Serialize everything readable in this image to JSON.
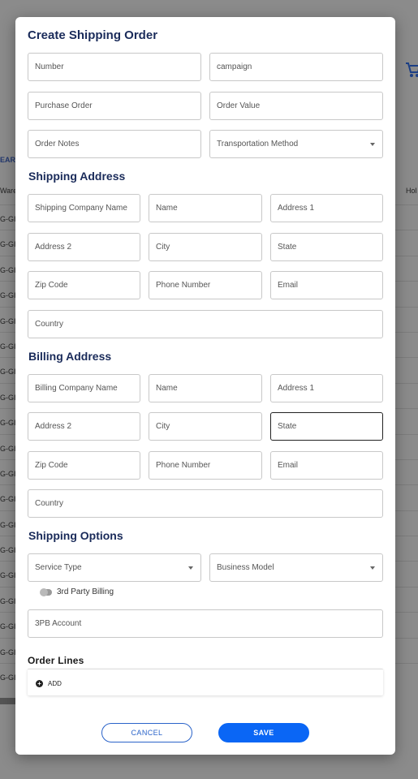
{
  "background": {
    "clear_label": "EAR",
    "col_left": "Ware",
    "col_right": "Hol",
    "row_text": "G-GI",
    "row_count": 19
  },
  "modal": {
    "title": "Create Shipping Order",
    "order_fields": {
      "number": "Number",
      "campaign": "campaign",
      "purchase_order": "Purchase Order",
      "order_value": "Order Value",
      "order_notes": "Order Notes",
      "transportation_method": "Transportation Method"
    },
    "shipping_address": {
      "title": "Shipping Address",
      "company": "Shipping Company Name",
      "name": "Name",
      "address1": "Address 1",
      "address2": "Address 2",
      "city": "City",
      "state": "State",
      "zip": "Zip Code",
      "phone": "Phone Number",
      "email": "Email",
      "country": "Country"
    },
    "billing_address": {
      "title": "Billing Address",
      "company": "Billing Company Name",
      "name": "Name",
      "address1": "Address 1",
      "address2": "Address 2",
      "city": "City",
      "state": "State",
      "zip": "Zip Code",
      "phone": "Phone Number",
      "email": "Email",
      "country": "Country"
    },
    "shipping_options": {
      "title": "Shipping Options",
      "service_type": "Service Type",
      "business_model": "Business Model",
      "third_party_billing": "3rd Party Billing",
      "third_party_billing_on": false,
      "tpb_account": "3PB Account"
    },
    "order_lines": {
      "title": "Order Lines",
      "add_label": "ADD"
    },
    "buttons": {
      "cancel": "CANCEL",
      "save": "SAVE"
    }
  }
}
